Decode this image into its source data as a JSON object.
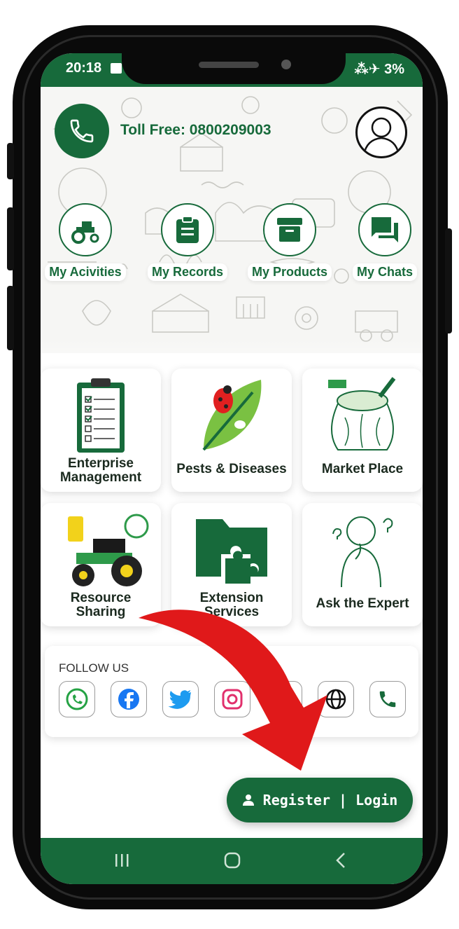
{
  "status": {
    "time": "20:18",
    "right_text": "⁂✈ 3%"
  },
  "header": {
    "tollfree": "Toll Free: 0800209003"
  },
  "quick_actions": [
    {
      "label": "My Acivities",
      "icon": "tractor-icon"
    },
    {
      "label": "My Records",
      "icon": "clipboard-icon"
    },
    {
      "label": "My Products",
      "icon": "archive-box-icon"
    },
    {
      "label": "My Chats",
      "icon": "chat-icon"
    }
  ],
  "tiles": [
    {
      "label1": "Enterprise",
      "label2": "Management",
      "icon": "checklist-clipboard-icon"
    },
    {
      "label1": "Pests & Diseases",
      "label2": "",
      "icon": "ladybug-leaf-icon"
    },
    {
      "label1": "Market Place",
      "label2": "",
      "icon": "produce-sack-icon"
    },
    {
      "label1": "Resource",
      "label2": "Sharing",
      "icon": "tractor-sprayer-icon"
    },
    {
      "label1": "Extension",
      "label2": "Services",
      "icon": "puzzle-folder-icon"
    },
    {
      "label1": "Ask the Expert",
      "label2": "",
      "icon": "thinking-person-icon"
    }
  ],
  "follow": {
    "title": "FOLLOW US",
    "socials": [
      "whatsapp-icon",
      "facebook-icon",
      "twitter-icon",
      "instagram-icon",
      "youtube-icon",
      "globe-icon",
      "phone-icon"
    ]
  },
  "register": {
    "label": "Register | Login"
  },
  "colors": {
    "brand": "#176a3b",
    "arrow": "#e0191a"
  }
}
